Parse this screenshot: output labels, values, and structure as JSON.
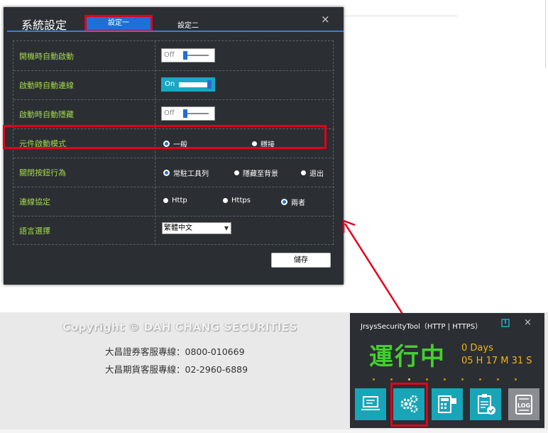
{
  "background_page": {
    "copyright": "Copyright © DAH CHANG SECURITIES",
    "hotlines": [
      "大昌證券客服專線：0800-010669",
      "大昌期貨客服專線：02-2960-6889"
    ]
  },
  "settings_dialog": {
    "title": "系統設定",
    "tabs": [
      {
        "label": "設定一",
        "active": true
      },
      {
        "label": "設定二",
        "active": false
      }
    ],
    "close": "×",
    "rows": [
      {
        "label": "開機時自動啟動",
        "type": "toggle",
        "state": "Off"
      },
      {
        "label": "啟動時自動連線",
        "type": "toggle",
        "state": "On"
      },
      {
        "label": "啟動時自動隱藏",
        "type": "toggle",
        "state": "Off"
      },
      {
        "label": "元件啟動模式",
        "type": "radio",
        "options": [
          "一般",
          "穩接"
        ],
        "selected": "一般"
      },
      {
        "label": "關閉按鈕行為",
        "type": "radio",
        "options": [
          "常駐工具列",
          "隱藏至背景",
          "退出"
        ],
        "selected": "常駐工具列"
      },
      {
        "label": "連線協定",
        "type": "radio",
        "options": [
          "Http",
          "Https",
          "兩者"
        ],
        "selected": "兩者"
      },
      {
        "label": "語言選擇",
        "type": "select",
        "value": "繁體中文"
      }
    ],
    "save_label": "儲存"
  },
  "tray_widget": {
    "title": "JrsysSecurityTool（HTTP | HTTPS）",
    "close": "×",
    "status": "運行中",
    "uptime_days": "0 Days",
    "uptime_hms": "05 H 17 M 31 S",
    "buttons": [
      "monitor-icon",
      "gear-icon",
      "calculator-icon",
      "clipboard-check-icon",
      "log-icon"
    ],
    "log_label": "LOG"
  },
  "colors": {
    "accent_blue": "#1f6fd6",
    "label_green": "#a3d84a",
    "status_green": "#43d02c",
    "uptime_orange": "#f2b31a",
    "highlight_red": "#e3001b",
    "tile_teal": "#18a5b8"
  }
}
